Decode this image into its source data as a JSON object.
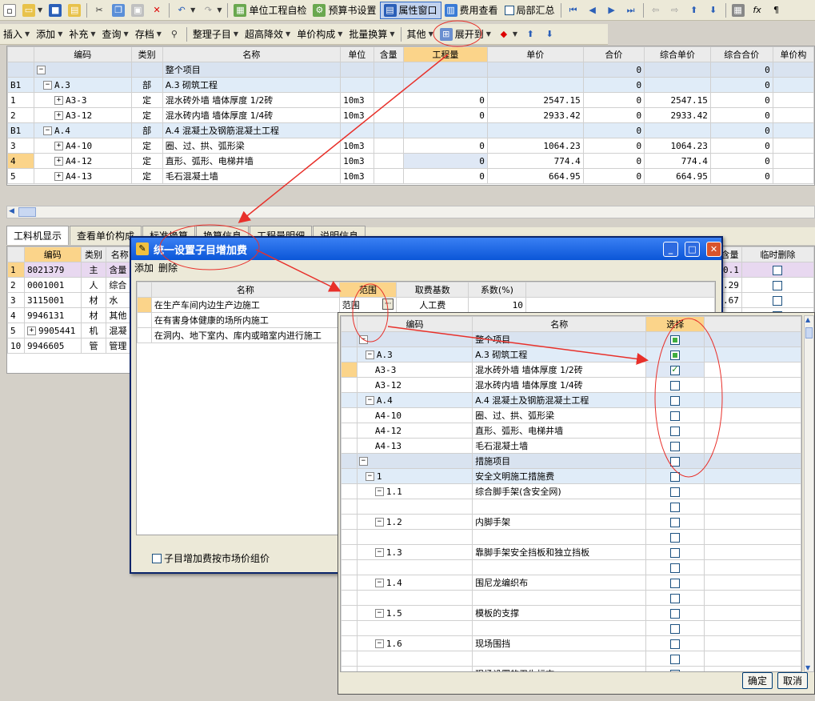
{
  "toolbar1": {
    "items": [
      "单位工程自检",
      "预算书设置",
      "属性窗口",
      "费用查看",
      "局部汇总"
    ]
  },
  "toolbar2": {
    "items": [
      "插入",
      "添加",
      "补充",
      "查询",
      "存档",
      "整理子目",
      "超高降效",
      "单价构成",
      "批量换算",
      "其他",
      "展开到"
    ]
  },
  "main_grid": {
    "columns": [
      "编码",
      "类别",
      "名称",
      "单位",
      "含量",
      "工程量",
      "单价",
      "合价",
      "综合单价",
      "综合合价",
      "单价构"
    ],
    "rows": [
      {
        "idx": "",
        "code": "",
        "type": "",
        "name": "整个项目",
        "unit": "",
        "content": "",
        "qty": "",
        "price": "",
        "total": "0",
        "cprice": "",
        "ctotal": "0",
        "style": "hdr"
      },
      {
        "idx": "B1",
        "code": "A.3",
        "type": "部",
        "name": "A.3 砌筑工程",
        "unit": "",
        "content": "",
        "qty": "",
        "price": "",
        "total": "0",
        "cprice": "",
        "ctotal": "0",
        "style": "blue"
      },
      {
        "idx": "1",
        "code": "A3-3",
        "type": "定",
        "name": "混水砖外墙 墙体厚度 1/2砖",
        "unit": "10m3",
        "content": "",
        "qty": "0",
        "price": "2547.15",
        "total": "0",
        "cprice": "2547.15",
        "ctotal": "0",
        "style": ""
      },
      {
        "idx": "2",
        "code": "A3-12",
        "type": "定",
        "name": "混水砖内墙 墙体厚度 1/4砖",
        "unit": "10m3",
        "content": "",
        "qty": "0",
        "price": "2933.42",
        "total": "0",
        "cprice": "2933.42",
        "ctotal": "0",
        "style": ""
      },
      {
        "idx": "B1",
        "code": "A.4",
        "type": "部",
        "name": "A.4 混凝土及钢筋混凝土工程",
        "unit": "",
        "content": "",
        "qty": "",
        "price": "",
        "total": "0",
        "cprice": "",
        "ctotal": "0",
        "style": "blue"
      },
      {
        "idx": "3",
        "code": "A4-10",
        "type": "定",
        "name": "圈、过、拱、弧形梁",
        "unit": "10m3",
        "content": "",
        "qty": "0",
        "price": "1064.23",
        "total": "0",
        "cprice": "1064.23",
        "ctotal": "0",
        "style": ""
      },
      {
        "idx": "4",
        "code": "A4-12",
        "type": "定",
        "name": "直形、弧形、电梯井墙",
        "unit": "10m3",
        "content": "",
        "qty": "0",
        "price": "774.4",
        "total": "0",
        "cprice": "774.4",
        "ctotal": "0",
        "style": "sel"
      },
      {
        "idx": "5",
        "code": "A4-13",
        "type": "定",
        "name": "毛石混凝土墙",
        "unit": "10m3",
        "content": "",
        "qty": "0",
        "price": "664.95",
        "total": "0",
        "cprice": "664.95",
        "ctotal": "0",
        "style": ""
      }
    ]
  },
  "bottom_tabs": [
    "工料机显示",
    "查看单价构成",
    "标准换算",
    "换算信息",
    "工程量明细",
    "说明信息"
  ],
  "bottom_grid": {
    "columns": [
      "编码",
      "类别",
      "名称"
    ],
    "rows": [
      {
        "idx": "1",
        "code": "8021379",
        "type": "主",
        "name": "含量"
      },
      {
        "idx": "2",
        "code": "0001001",
        "type": "人",
        "name": "综合"
      },
      {
        "idx": "3",
        "code": "3115001",
        "type": "材",
        "name": "水"
      },
      {
        "idx": "4",
        "code": "9946131",
        "type": "材",
        "name": "其他"
      },
      {
        "idx": "5",
        "code": "9905441",
        "type": "机",
        "name": "混凝"
      },
      {
        "idx": "10",
        "code": "9946605",
        "type": "管",
        "name": "管理"
      }
    ]
  },
  "right_grid": {
    "columns": [
      "含量",
      "临时删除"
    ],
    "values": [
      "0.1",
      ".29",
      ".67",
      "",
      "",
      ""
    ]
  },
  "dialog": {
    "title": "统一设置子目增加费",
    "menu": [
      "添加",
      "删除"
    ],
    "columns": [
      "名称",
      "范围",
      "取费基数",
      "系数(%)"
    ],
    "rows": [
      {
        "name": "在生产车间内边生产边施工",
        "scope": "范围",
        "base": "人工费",
        "coef": "10"
      },
      {
        "name": "在有害身体健康的场所内施工",
        "scope": "",
        "base": "",
        "coef": ""
      },
      {
        "name": "在洞内、地下室内、库内或暗室内进行施工",
        "scope": "",
        "base": "",
        "coef": ""
      }
    ],
    "checkbox_label": "子目增加费按市场价组价"
  },
  "popup": {
    "columns": [
      "编码",
      "名称",
      "选择"
    ],
    "rows": [
      {
        "code": "",
        "name": "整个项目",
        "state": "partial",
        "level": 0,
        "exp": "−"
      },
      {
        "code": "A.3",
        "name": "A.3 砌筑工程",
        "state": "partial",
        "level": 1,
        "exp": "−"
      },
      {
        "code": "A3-3",
        "name": "混水砖外墙 墙体厚度 1/2砖",
        "state": "checked",
        "level": 2,
        "exp": "",
        "sel": true
      },
      {
        "code": "A3-12",
        "name": "混水砖内墙 墙体厚度 1/4砖",
        "state": "",
        "level": 2,
        "exp": ""
      },
      {
        "code": "A.4",
        "name": "A.4 混凝土及钢筋混凝土工程",
        "state": "",
        "level": 1,
        "exp": "−"
      },
      {
        "code": "A4-10",
        "name": "圈、过、拱、弧形梁",
        "state": "",
        "level": 2,
        "exp": ""
      },
      {
        "code": "A4-12",
        "name": "直形、弧形、电梯井墙",
        "state": "",
        "level": 2,
        "exp": ""
      },
      {
        "code": "A4-13",
        "name": "毛石混凝土墙",
        "state": "",
        "level": 2,
        "exp": ""
      },
      {
        "code": "",
        "name": "措施项目",
        "state": "",
        "level": 0,
        "exp": "−"
      },
      {
        "code": "1",
        "name": "安全文明施工措施费",
        "state": "",
        "level": 1,
        "exp": "−"
      },
      {
        "code": "1.1",
        "name": "综合脚手架(含安全网)",
        "state": "",
        "level": 2,
        "exp": "−"
      },
      {
        "code": "",
        "name": "",
        "state": "",
        "level": 3,
        "exp": ""
      },
      {
        "code": "1.2",
        "name": "内脚手架",
        "state": "",
        "level": 2,
        "exp": "−"
      },
      {
        "code": "",
        "name": "",
        "state": "",
        "level": 3,
        "exp": ""
      },
      {
        "code": "1.3",
        "name": "靠脚手架安全挡板和独立挡板",
        "state": "",
        "level": 2,
        "exp": "−"
      },
      {
        "code": "",
        "name": "",
        "state": "",
        "level": 3,
        "exp": ""
      },
      {
        "code": "1.4",
        "name": "围尼龙编织布",
        "state": "",
        "level": 2,
        "exp": "−"
      },
      {
        "code": "",
        "name": "",
        "state": "",
        "level": 3,
        "exp": ""
      },
      {
        "code": "1.5",
        "name": "模板的支撑",
        "state": "",
        "level": 2,
        "exp": "−"
      },
      {
        "code": "",
        "name": "",
        "state": "",
        "level": 3,
        "exp": ""
      },
      {
        "code": "1.6",
        "name": "现场围挡",
        "state": "",
        "level": 2,
        "exp": "−"
      },
      {
        "code": "",
        "name": "",
        "state": "",
        "level": 3,
        "exp": ""
      },
      {
        "code": "",
        "name": "现场设置的卫生标志",
        "state": "",
        "level": 2,
        "exp": ""
      }
    ],
    "ok_label": "确定",
    "cancel_label": "取消"
  },
  "colors": {
    "accent": "#316ac5",
    "annotation_red": "#e8302a",
    "title_bar": "#0b56d8"
  }
}
